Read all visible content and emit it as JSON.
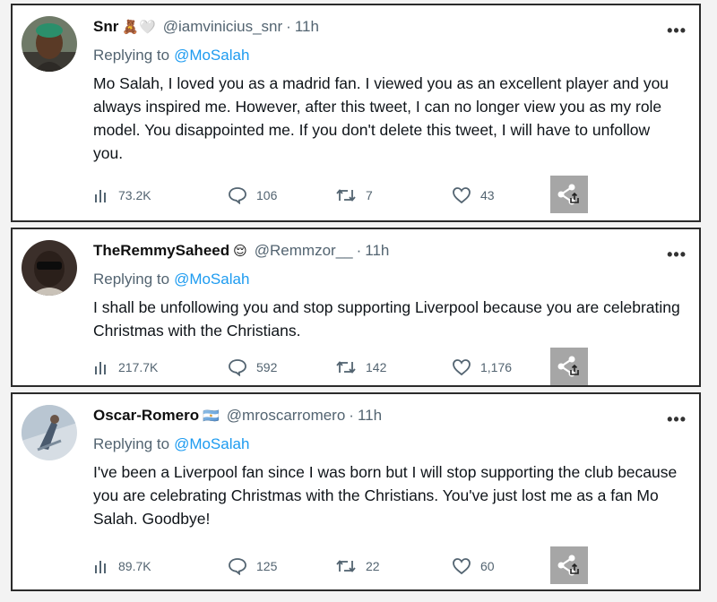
{
  "tweets": [
    {
      "name": "Snr",
      "badges": "🧸🤍",
      "handle": "@iamvinicius_snr",
      "time": "11h",
      "replying_prefix": "Replying to",
      "replying_to": "@MoSalah",
      "text": "Mo Salah, I loved you as a madrid fan. I viewed you as an excellent player and you always inspired me. However, after this tweet, I can no longer view you as my role model. You disappointed me. If you don't delete this tweet, I will have to unfollow you.",
      "views": "73.2K",
      "replies": "106",
      "retweets": "7",
      "likes": "43",
      "more": "•••"
    },
    {
      "name": "TheRemmySaheed",
      "badges": "😌",
      "handle": "@Remmzor__",
      "time": "11h",
      "replying_prefix": "Replying to",
      "replying_to": "@MoSalah",
      "text": "I shall be unfollowing you and stop supporting Liverpool because you are celebrating Christmas with the Christians.",
      "views": "217.7K",
      "replies": "592",
      "retweets": "142",
      "likes": "1,176",
      "more": "•••"
    },
    {
      "name": "Oscar-Romero",
      "badges": "🇦🇷",
      "handle": "@mroscarromero",
      "time": "11h",
      "replying_prefix": "Replying to",
      "replying_to": "@MoSalah",
      "text": "I've been a Liverpool fan since I was born but I will stop supporting the club because you are celebrating Christmas with the Christians. You've just lost me as a fan Mo Salah. Goodbye!",
      "views": "89.7K",
      "replies": "125",
      "retweets": "22",
      "likes": "60",
      "more": "•••"
    }
  ],
  "icons": {
    "views": "bar-chart-icon",
    "reply": "speech-bubble-icon",
    "retweet": "retweet-icon",
    "like": "heart-icon",
    "share": "share-icon"
  },
  "colors": {
    "link": "#1d9bf0",
    "muted": "#536471",
    "share_bg": "#a6a6a6"
  }
}
